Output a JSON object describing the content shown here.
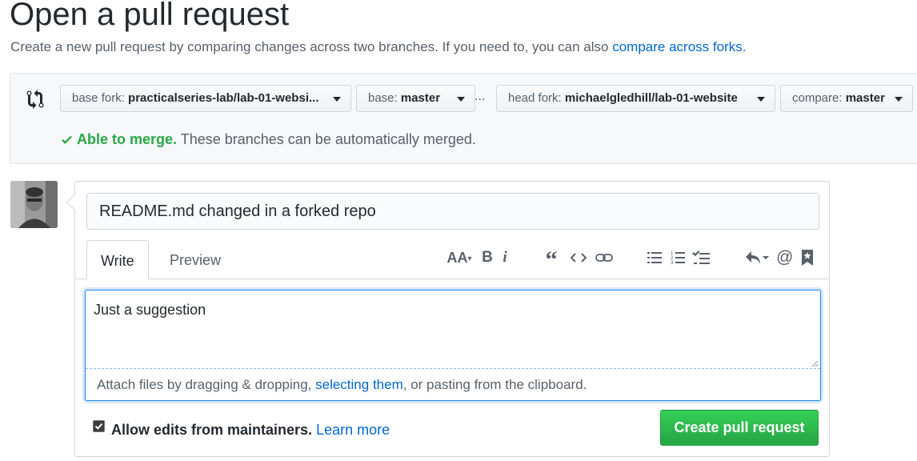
{
  "page": {
    "title": "Open a pull request",
    "subtitle_text": "Create a new pull request by comparing changes across two branches. If you need to, you can also ",
    "subtitle_link": "compare across forks",
    "subtitle_end": "."
  },
  "compare": {
    "base_fork_label": "base fork:",
    "base_fork_value": "practicalseries-lab/lab-01-websi...",
    "base_label": "base:",
    "base_value": "master",
    "separator": "...",
    "head_fork_label": "head fork:",
    "head_fork_value": "michaelgledhill/lab-01-website",
    "compare_label": "compare:",
    "compare_value": "master",
    "merge_status": "Able to merge.",
    "merge_detail": " These branches can be automatically merged."
  },
  "form": {
    "title_value": "README.md changed in a forked repo",
    "tabs": [
      {
        "label": "Write"
      },
      {
        "label": "Preview"
      }
    ],
    "toolbar": {
      "heading": "AA",
      "bold": "B",
      "italic": "i",
      "quote": "“",
      "mention": "@"
    },
    "body_value": "Just a suggestion",
    "attach_text_1": "Attach files by dragging & dropping, ",
    "attach_link": "selecting them",
    "attach_text_2": ", or pasting from the clipboard.",
    "allow_edits_label": "Allow edits from maintainers.",
    "learn_more": "Learn more",
    "submit_label": "Create pull request"
  },
  "colors": {
    "link": "#0366d6",
    "success": "#28a745",
    "button_green": "#2ea44f"
  }
}
